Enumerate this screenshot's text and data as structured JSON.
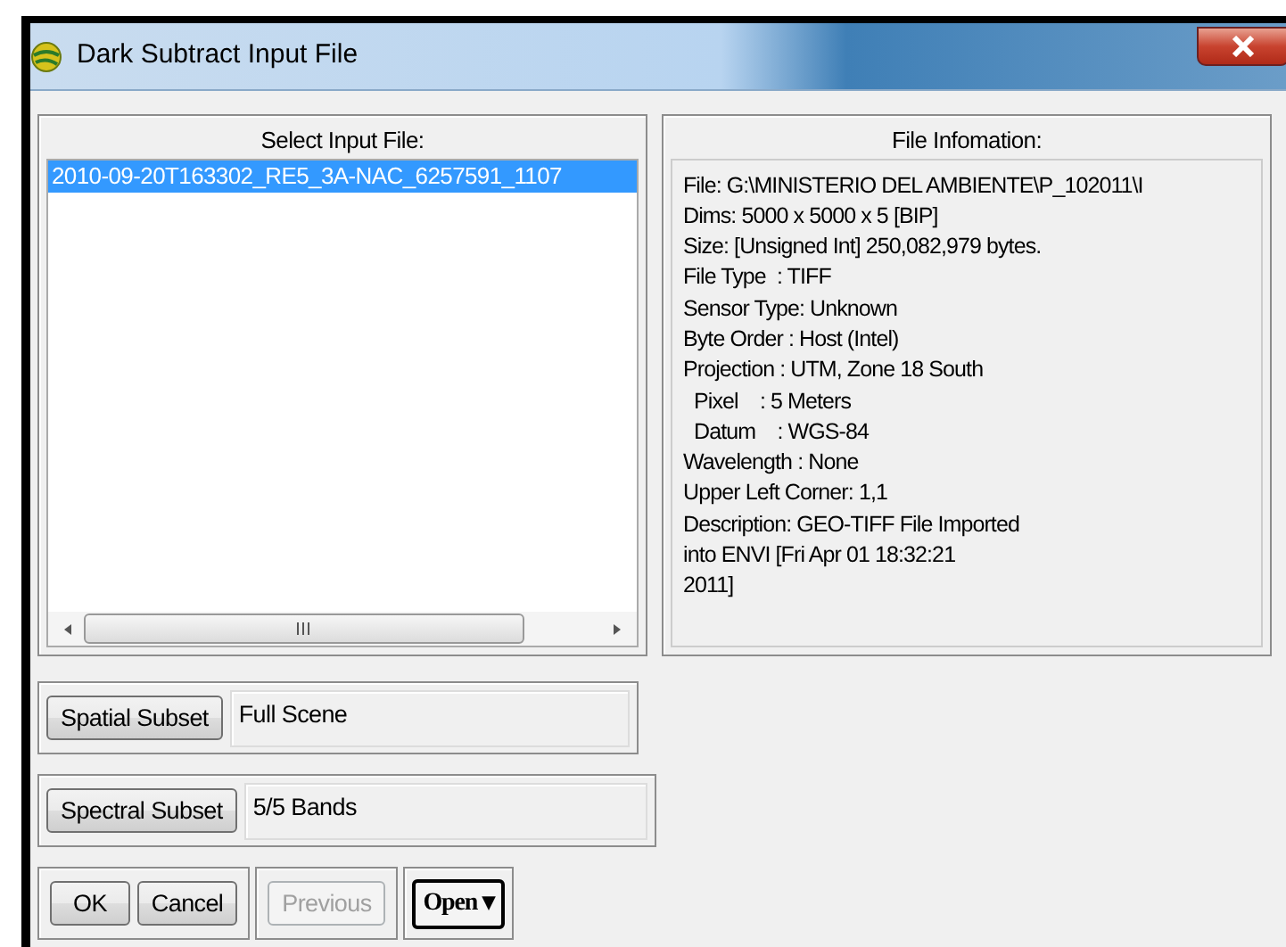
{
  "window": {
    "title": "Dark Subtract Input File"
  },
  "input_files": {
    "heading": "Select Input File:",
    "items": [
      {
        "label": "2010-09-20T163302_RE5_3A-NAC_6257591_1107",
        "selected": true
      }
    ]
  },
  "file_information": {
    "heading": "File Infomation:",
    "lines": [
      "File: G:\\MINISTERIO DEL AMBIENTE\\P_102011\\I",
      "Dims: 5000 x 5000 x 5 [BIP]",
      "Size: [Unsigned Int] 250,082,979 bytes.",
      "File Type  : TIFF",
      "Sensor Type: Unknown",
      "Byte Order : Host (Intel)",
      "Projection : UTM, Zone 18 South",
      "  Pixel    : 5 Meters",
      "  Datum    : WGS-84",
      "Wavelength : None",
      "Upper Left Corner: 1,1",
      "Description: GEO-TIFF File Imported",
      "into ENVI [Fri Apr 01 18:32:21",
      "2011]"
    ]
  },
  "spatial_subset": {
    "button": "Spatial Subset",
    "value": "Full Scene"
  },
  "spectral_subset": {
    "button": "Spectral Subset",
    "value": "5/5 Bands"
  },
  "buttons": [
    {
      "label": "OK",
      "disabled": false
    },
    {
      "label": "Cancel",
      "disabled": false
    },
    {
      "label": "Previous",
      "disabled": true
    }
  ],
  "open_menu": {
    "label": "Open",
    "caret": "▾"
  }
}
